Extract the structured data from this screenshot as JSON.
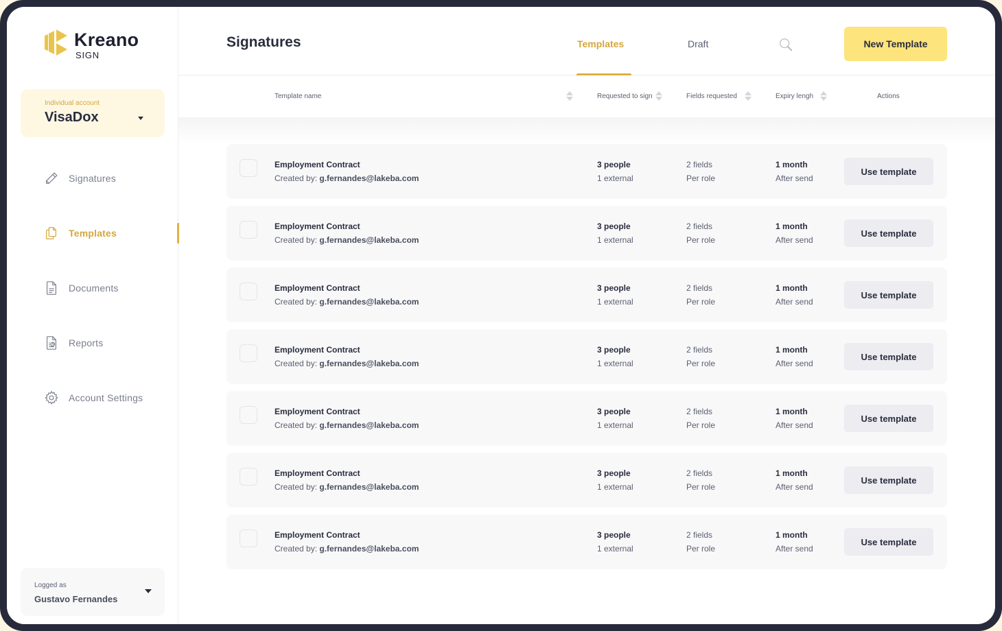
{
  "brand": {
    "name": "Kreano",
    "sub": "SIGN",
    "accent": "#e0b042",
    "button_color": "#fde47c"
  },
  "account": {
    "label": "Individual account",
    "name": "VisaDox"
  },
  "sidebar": {
    "items": [
      {
        "label": "Signatures",
        "icon": "pencil-icon",
        "active": false
      },
      {
        "label": "Templates",
        "icon": "templates-icon",
        "active": true
      },
      {
        "label": "Documents",
        "icon": "document-icon",
        "active": false
      },
      {
        "label": "Reports",
        "icon": "report-icon",
        "active": false
      },
      {
        "label": "Account Settings",
        "icon": "gear-icon",
        "active": false
      }
    ]
  },
  "user": {
    "label": "Logged as",
    "name": "Gustavo Fernandes"
  },
  "header": {
    "title": "Signatures",
    "tabs": [
      {
        "label": "Templates",
        "active": true
      },
      {
        "label": "Draft",
        "active": false
      }
    ],
    "new_button": "New Template"
  },
  "table": {
    "columns": [
      "Template name",
      "Requested to sign",
      "Fields requested",
      "Expiry lengh",
      "Actions"
    ],
    "rows": [
      {
        "name": "Employment Contract",
        "created_label": "Created by:",
        "created_by": "g.fernandes@lakeba.com",
        "people": "3 people",
        "external": "1 external",
        "fields": "2 fields",
        "fields_sub": "Per role",
        "expiry": "1 month",
        "expiry_sub": "After send",
        "action": "Use template"
      },
      {
        "name": "Employment Contract",
        "created_label": "Created by:",
        "created_by": "g.fernandes@lakeba.com",
        "people": "3 people",
        "external": "1 external",
        "fields": "2 fields",
        "fields_sub": "Per role",
        "expiry": "1 month",
        "expiry_sub": "After send",
        "action": "Use template"
      },
      {
        "name": "Employment Contract",
        "created_label": "Created by:",
        "created_by": "g.fernandes@lakeba.com",
        "people": "3 people",
        "external": "1 external",
        "fields": "2 fields",
        "fields_sub": "Per role",
        "expiry": "1 month",
        "expiry_sub": "After send",
        "action": "Use template"
      },
      {
        "name": "Employment Contract",
        "created_label": "Created by:",
        "created_by": "g.fernandes@lakeba.com",
        "people": "3 people",
        "external": "1 external",
        "fields": "2 fields",
        "fields_sub": "Per role",
        "expiry": "1 month",
        "expiry_sub": "After send",
        "action": "Use template"
      },
      {
        "name": "Employment Contract",
        "created_label": "Created by:",
        "created_by": "g.fernandes@lakeba.com",
        "people": "3 people",
        "external": "1 external",
        "fields": "2 fields",
        "fields_sub": "Per role",
        "expiry": "1 month",
        "expiry_sub": "After send",
        "action": "Use template"
      },
      {
        "name": "Employment Contract",
        "created_label": "Created by:",
        "created_by": "g.fernandes@lakeba.com",
        "people": "3 people",
        "external": "1 external",
        "fields": "2 fields",
        "fields_sub": "Per role",
        "expiry": "1 month",
        "expiry_sub": "After send",
        "action": "Use template"
      },
      {
        "name": "Employment Contract",
        "created_label": "Created by:",
        "created_by": "g.fernandes@lakeba.com",
        "people": "3 people",
        "external": "1 external",
        "fields": "2 fields",
        "fields_sub": "Per role",
        "expiry": "1 month",
        "expiry_sub": "After send",
        "action": "Use template"
      }
    ]
  }
}
